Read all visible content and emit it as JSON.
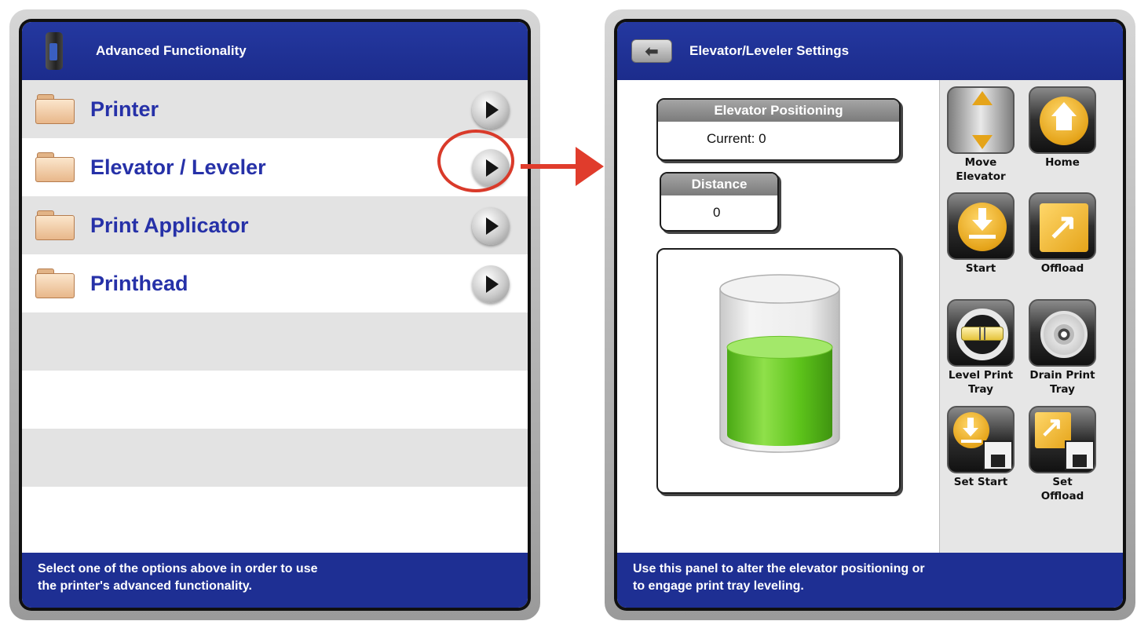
{
  "left_panel": {
    "title": "Advanced Functionality",
    "items": [
      {
        "label": "Printer"
      },
      {
        "label": "Elevator / Leveler"
      },
      {
        "label": "Print Applicator"
      },
      {
        "label": "Printhead"
      }
    ],
    "footer_line1": "Select one of the options above in order to use",
    "footer_line2": "the printer's advanced functionality."
  },
  "right_panel": {
    "title": "Elevator/Leveler Settings",
    "elevator_positioning": {
      "title": "Elevator Positioning",
      "current_label": "Current:",
      "current_value": "0"
    },
    "distance": {
      "title": "Distance",
      "value": "0"
    },
    "tank_fill_fraction": 0.6,
    "tank_fill_color": "#5cc21a",
    "actions": [
      {
        "line1": "Move",
        "line2": "Elevator",
        "icon": "move-elevator-icon"
      },
      {
        "line1": "Home",
        "line2": "",
        "icon": "home-icon"
      },
      {
        "line1": "Start",
        "line2": "",
        "icon": "start-icon"
      },
      {
        "line1": "Offload",
        "line2": "",
        "icon": "offload-icon"
      },
      {
        "line1": "Level Print",
        "line2": "Tray",
        "icon": "level-icon"
      },
      {
        "line1": "Drain Print",
        "line2": "Tray",
        "icon": "drain-icon"
      },
      {
        "line1": "Set Start",
        "line2": "",
        "icon": "set-start-icon"
      },
      {
        "line1": "Set",
        "line2": "Offload",
        "icon": "set-offload-icon"
      }
    ],
    "footer_line1": "Use this panel to alter the elevator positioning or",
    "footer_line2": "to engage print tray leveling."
  },
  "colors": {
    "header_blue": "#1c2c8c",
    "label_blue": "#2631a8",
    "highlight_red": "#d93a2a",
    "gold": "#e5a41a"
  }
}
